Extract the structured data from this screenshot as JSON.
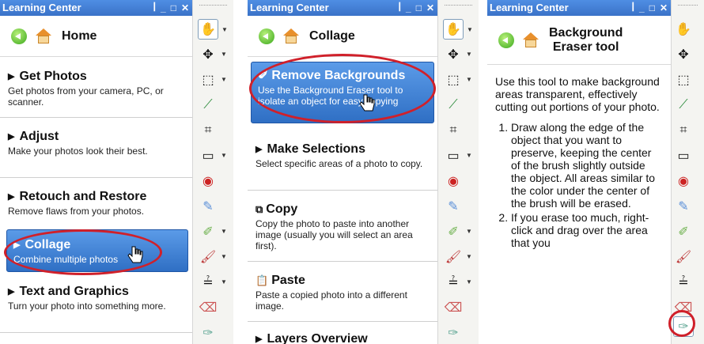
{
  "panels": [
    {
      "window_title": "Learning Center",
      "nav_title": "Home",
      "sections": [
        {
          "title": "Get Photos",
          "desc": "Get photos from your camera, PC, or scanner."
        },
        {
          "title": "Adjust",
          "desc": "Make your photos look their best."
        },
        {
          "title": "Retouch and Restore",
          "desc": "Remove flaws from your photos."
        },
        {
          "title": "Collage",
          "desc": "Combine multiple photos"
        },
        {
          "title": "Text and Graphics",
          "desc": "Turn your photo into something more."
        }
      ]
    },
    {
      "window_title": "Learning Center",
      "nav_title": "Collage",
      "sections": [
        {
          "title": "Remove Backgrounds",
          "desc": "Use the Background Eraser tool to isolate an object for easy copying"
        },
        {
          "title": "Make Selections",
          "desc": "Select specific areas of a photo to copy."
        },
        {
          "title": "Copy",
          "desc": "Copy the photo to paste into another image (usually you will select an area first)."
        },
        {
          "title": "Paste",
          "desc": "Paste a copied photo into a different image."
        },
        {
          "title": "Layers Overview",
          "desc": ""
        }
      ]
    },
    {
      "window_title": "Learning Center",
      "nav_title_line1": "Background",
      "nav_title_line2": "Eraser tool",
      "intro": "Use this tool to make background areas transparent, effectively cutting out portions of your photo.",
      "steps": [
        "Draw along the edge of the object that you want to preserve, keeping the center of the brush slightly outside the object. All areas similar to the color under the center of the brush will be erased.",
        "If you erase too much, right-click and drag over the area that you"
      ]
    }
  ],
  "toolbar_tools": [
    "pan-hand",
    "move",
    "marquee-select",
    "eyedropper",
    "crop",
    "rectangle-shape",
    "red-eye",
    "retouch",
    "clone",
    "paint-brush",
    "levels",
    "eraser",
    "background-eraser",
    "bucket"
  ],
  "colors": {
    "title_blue": "#3a72c8",
    "selection_blue": "#2f6fc4",
    "highlight_red": "#d0202a"
  }
}
